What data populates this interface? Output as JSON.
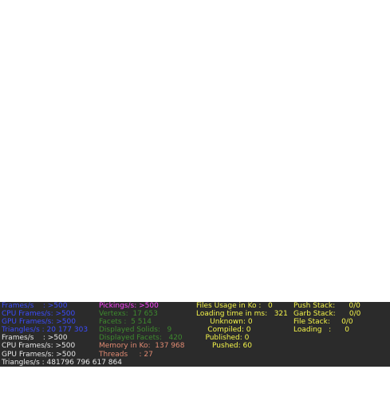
{
  "colors": {
    "blue": "#3b4cff",
    "white": "#e8e8e8",
    "magenta": "#ff45ff",
    "green": "#3e8a2e",
    "salmon": "#e08a72",
    "yellow": "#f5f54a",
    "panel_bg": "#2b2b2b"
  },
  "stats": {
    "col1": [
      {
        "text": "Frames/s    : >500",
        "color": "blue"
      },
      {
        "text": "CPU Frames/s: >500",
        "color": "blue"
      },
      {
        "text": "GPU Frames/s: >500",
        "color": "blue"
      },
      {
        "text": "Triangles/s : 20 177 303",
        "color": "blue"
      },
      {
        "text": "Frames/s    : >500",
        "color": "white"
      },
      {
        "text": "CPU Frames/s: >500",
        "color": "white"
      },
      {
        "text": "GPU Frames/s: >500",
        "color": "white"
      },
      {
        "text": "Triangles/s : 481796 796 617 864",
        "color": "white"
      }
    ],
    "col2": [
      {
        "text": "Pickings/s: >500",
        "color": "magenta"
      },
      {
        "text": "Vertexs:  17 653",
        "color": "green"
      },
      {
        "text": "Facets :  5 514",
        "color": "green"
      },
      {
        "text": "Displayed Solids:   9",
        "color": "green"
      },
      {
        "text": "Displayed Facets:   420",
        "color": "green"
      },
      {
        "text": "Memory in Ko:  137 968",
        "color": "salmon"
      },
      {
        "text": "Threads     : 27",
        "color": "salmon"
      }
    ],
    "col3": [
      {
        "text": "Files Usage in Ko :   0",
        "color": "yellow"
      },
      {
        "text": "Loading time in ms:   321",
        "color": "yellow"
      },
      {
        "text": "      Unknown: 0",
        "color": "yellow"
      },
      {
        "text": "     Compiled: 0",
        "color": "yellow"
      },
      {
        "text": "    Published: 0",
        "color": "yellow"
      },
      {
        "text": "       Pushed: 60",
        "color": "yellow"
      }
    ],
    "col4": [
      {
        "text": "Push Stack:      0/0",
        "color": "yellow"
      },
      {
        "text": "Garb Stack:      0/0",
        "color": "yellow"
      },
      {
        "text": "File Stack:     0/0",
        "color": "yellow"
      },
      {
        "text": "Loading   :      0",
        "color": "yellow"
      }
    ]
  }
}
